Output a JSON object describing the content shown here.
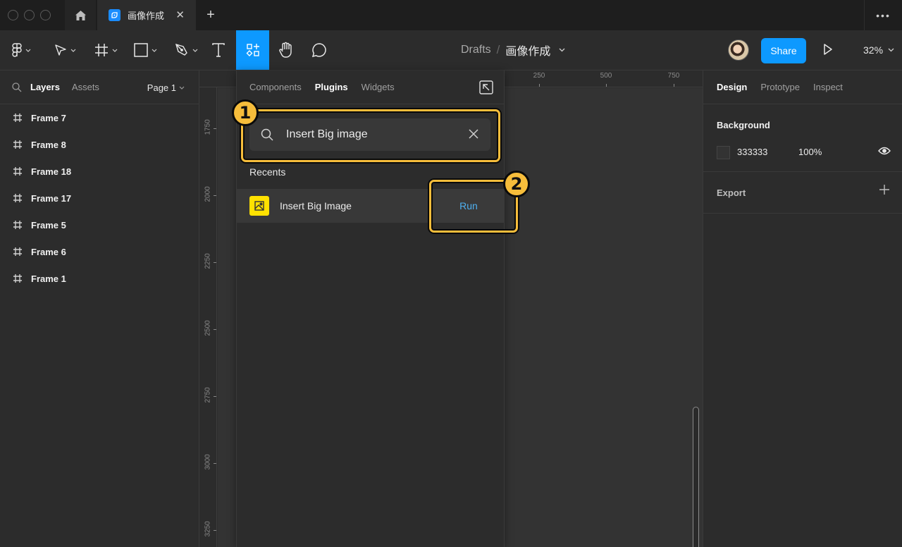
{
  "tabbar": {
    "file_tab_title": "画像作成",
    "close_glyph": "✕",
    "new_tab_glyph": "+",
    "more_glyph": "•••"
  },
  "toolbar": {
    "breadcrumb": {
      "folder": "Drafts",
      "separator": "/",
      "file": "画像作成"
    },
    "share_label": "Share",
    "zoom_level": "32%",
    "active_tool": "resources",
    "accent_color": "#0d99ff"
  },
  "left_panel": {
    "tabs": [
      {
        "label": "Layers",
        "active": true
      },
      {
        "label": "Assets",
        "active": false
      }
    ],
    "page_selector": "Page 1",
    "layers": [
      {
        "name": "Frame 7"
      },
      {
        "name": "Frame 8"
      },
      {
        "name": "Frame 18"
      },
      {
        "name": "Frame 17"
      },
      {
        "name": "Frame 5"
      },
      {
        "name": "Frame 6"
      },
      {
        "name": "Frame 1"
      }
    ]
  },
  "rulers": {
    "horizontal": [
      "250",
      "500",
      "750"
    ],
    "vertical": [
      "1750",
      "2000",
      "2250",
      "2500",
      "2750",
      "3000",
      "3250"
    ]
  },
  "plugin_panel": {
    "tabs": [
      {
        "label": "Components",
        "active": false
      },
      {
        "label": "Plugins",
        "active": true
      },
      {
        "label": "Widgets",
        "active": false
      }
    ],
    "search_value": "Insert Big image",
    "recents_label": "Recents",
    "recent_items": [
      {
        "name": "Insert Big Image",
        "action_label": "Run",
        "icon_color": "#ffe100"
      }
    ]
  },
  "annotations": [
    {
      "number": "1",
      "target": "plugin-search-field"
    },
    {
      "number": "2",
      "target": "run-button"
    }
  ],
  "annotation_color": "#f6bd3b",
  "right_panel": {
    "tabs": [
      {
        "label": "Design",
        "active": true
      },
      {
        "label": "Prototype",
        "active": false
      },
      {
        "label": "Inspect",
        "active": false
      }
    ],
    "background": {
      "title": "Background",
      "hex": "333333",
      "opacity": "100%",
      "swatch_color": "#333333"
    },
    "export": {
      "title": "Export"
    }
  }
}
